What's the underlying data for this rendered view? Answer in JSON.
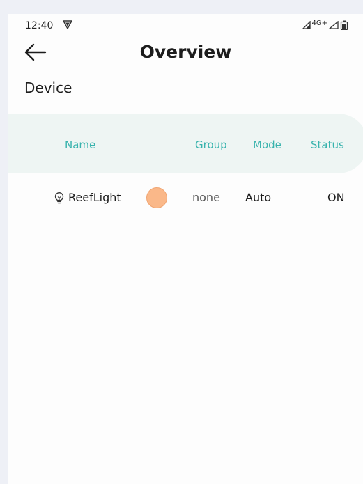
{
  "status_bar": {
    "time": "12:40",
    "network": "4G+"
  },
  "app_bar": {
    "title": "Overview"
  },
  "section": {
    "title": "Device"
  },
  "table": {
    "headers": {
      "name": "Name",
      "group": "Group",
      "mode": "Mode",
      "status": "Status"
    },
    "rows": [
      {
        "icon": "lightbulb-icon",
        "name": "ReefLight",
        "color": "#fab889",
        "group": "none",
        "mode": "Auto",
        "status": "ON"
      }
    ]
  },
  "colors": {
    "accent": "#38b3ad",
    "header_bg": "#eef5f3"
  }
}
